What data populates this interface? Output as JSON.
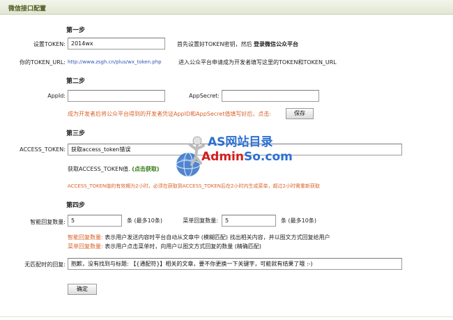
{
  "header": {
    "title": "微信接口配置"
  },
  "step1": {
    "heading": "第一步",
    "token_label": "设置TOKEN:",
    "token_value": "2014wx",
    "token_hint_prefix": "首先设置好TOKEN密钥，然后",
    "token_hint_bold": "登录微信公众平台",
    "token_url_label": "你的TOKEN_URL:",
    "token_url_value": "http://www.zsgh.cn/plus/wx_token.php",
    "token_url_hint": "进入公众平台申请成为开发者填写这里的TOKEN和TOKEN_URL"
  },
  "step2": {
    "heading": "第二步",
    "appid_label": "AppId:",
    "appid_value": "",
    "appsecret_label": "AppSecret:",
    "appsecret_value": "",
    "hint": "成为开发者后将公众平台得到的开发者凭证AppID和AppSecret值填写好后，点击:",
    "save_label": "保存"
  },
  "step3": {
    "heading": "第三步",
    "access_token_label": "ACCESS_TOKEN:",
    "access_token_value": "获取access_token错误",
    "get_text": "获取ACCESS_TOKEN值.",
    "get_link": "(点击获取)",
    "notice": "ACCESS_TOKEN值的有效期为2小时，必须在获取到ACCESS_TOKEN后在2小时内生成菜单，超过2小时需重新获取"
  },
  "step4": {
    "heading": "第四步",
    "smart_label": "智能回复数量:",
    "smart_value": "5",
    "smart_unit": "条 (最多10条)",
    "menu_label": "菜单回复数量:",
    "menu_value": "5",
    "menu_unit": "条 (最多10条)",
    "desc1_key": "智能回复数量:",
    "desc1_text": "表示用户发送内容时平台自动从文章中 (模糊匹配) 找出相关内容，并以图文方式回复给用户",
    "desc2_key": "菜单回复数量:",
    "desc2_text": "表示用户点击菜单时，向用户以图文方式回复的数量 (精确匹配)"
  },
  "nomatch": {
    "label": "无匹配时的回复:",
    "value": "抱歉，没有找到与标题: 【{通配符}】相关的文章，要不你更换一下关键字，可能就有结果了哦 :-)"
  },
  "submit_label": "确定",
  "watermark": {
    "line1": "AS网站目录",
    "line2_part1": "Admin",
    "line2_part2": "So.com"
  }
}
